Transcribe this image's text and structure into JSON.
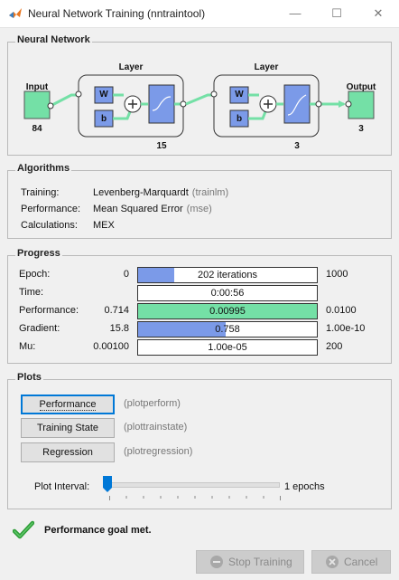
{
  "window": {
    "title": "Neural Network Training (nntraintool)",
    "minimize": "—",
    "maximize": "☐",
    "close": "✕"
  },
  "network": {
    "section_title": "Neural Network",
    "input_label": "Input",
    "input_size": "84",
    "output_label": "Output",
    "output_size": "3",
    "layers": [
      {
        "label": "Layer",
        "size": "15",
        "w": "W",
        "b": "b",
        "activation": "tansig"
      },
      {
        "label": "Layer",
        "size": "3",
        "w": "W",
        "b": "b",
        "activation": "logsig"
      }
    ]
  },
  "algorithms": {
    "section_title": "Algorithms",
    "rows": [
      {
        "label": "Training:",
        "value": "Levenberg-Marquardt",
        "fn": "(trainlm)"
      },
      {
        "label": "Performance:",
        "value": "Mean Squared Error",
        "fn": "(mse)"
      },
      {
        "label": "Calculations:",
        "value": "MEX",
        "fn": ""
      }
    ]
  },
  "progress": {
    "section_title": "Progress",
    "rows": [
      {
        "label": "Epoch:",
        "start": "0",
        "text": "202 iterations",
        "end": "1000",
        "fill_fraction": 0.202,
        "fill_color": "#7b9ae8"
      },
      {
        "label": "Time:",
        "start": "",
        "text": "0:00:56",
        "end": "",
        "fill_fraction": 0,
        "fill_color": "#ffffff"
      },
      {
        "label": "Performance:",
        "start": "0.714",
        "text": "0.00995",
        "end": "0.0100",
        "fill_fraction": 1.0,
        "fill_color": "#74e0a6"
      },
      {
        "label": "Gradient:",
        "start": "15.8",
        "text": "0.758",
        "end": "1.00e-10",
        "fill_fraction": 0.49,
        "fill_color": "#7b9ae8"
      },
      {
        "label": "Mu:",
        "start": "0.00100",
        "text": "1.00e-05",
        "end": "200",
        "fill_fraction": 0,
        "fill_color": "#ffffff"
      }
    ]
  },
  "plots": {
    "section_title": "Plots",
    "buttons": [
      {
        "label": "Performance",
        "fn": "(plotperform)"
      },
      {
        "label": "Training State",
        "fn": "(plottrainstate)"
      },
      {
        "label": "Regression",
        "fn": "(plotregression)"
      }
    ],
    "interval_label": "Plot Interval:",
    "interval_value": "1 epochs"
  },
  "status": {
    "message": "Performance goal met.",
    "icon": "checkmark-icon",
    "color": "#2e9d37"
  },
  "footer": {
    "stop_label": "Stop Training",
    "cancel_label": "Cancel"
  }
}
